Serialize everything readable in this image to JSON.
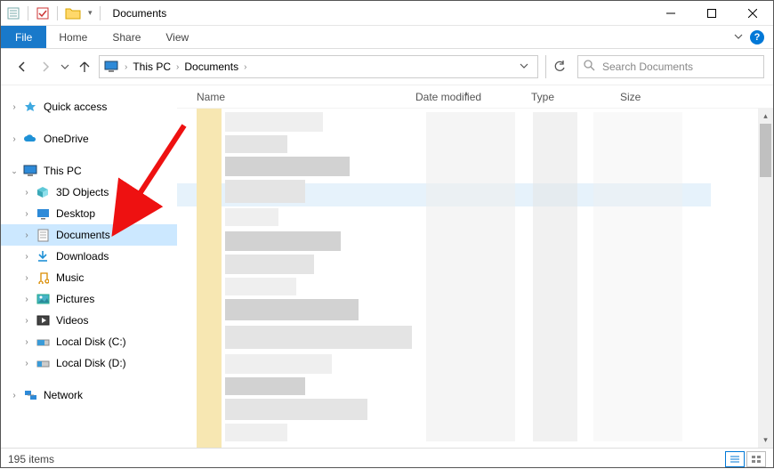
{
  "window": {
    "title": "Documents",
    "qat_sep": "|",
    "dropdown_glyph": "▾"
  },
  "ribbon": {
    "file": "File",
    "tabs": [
      "Home",
      "Share",
      "View"
    ],
    "help_glyph": "?"
  },
  "nav": {
    "breadcrumb": [
      "This PC",
      "Documents"
    ],
    "crumb_sep": "›",
    "search_placeholder": "Search Documents"
  },
  "tree": {
    "quick_access": "Quick access",
    "onedrive": "OneDrive",
    "this_pc": "This PC",
    "children": [
      "3D Objects",
      "Desktop",
      "Documents",
      "Downloads",
      "Music",
      "Pictures",
      "Videos",
      "Local Disk (C:)",
      "Local Disk (D:)"
    ],
    "network": "Network"
  },
  "columns": {
    "name": "Name",
    "date": "Date modified",
    "type": "Type",
    "size": "Size"
  },
  "status": {
    "item_count": "195 items"
  }
}
